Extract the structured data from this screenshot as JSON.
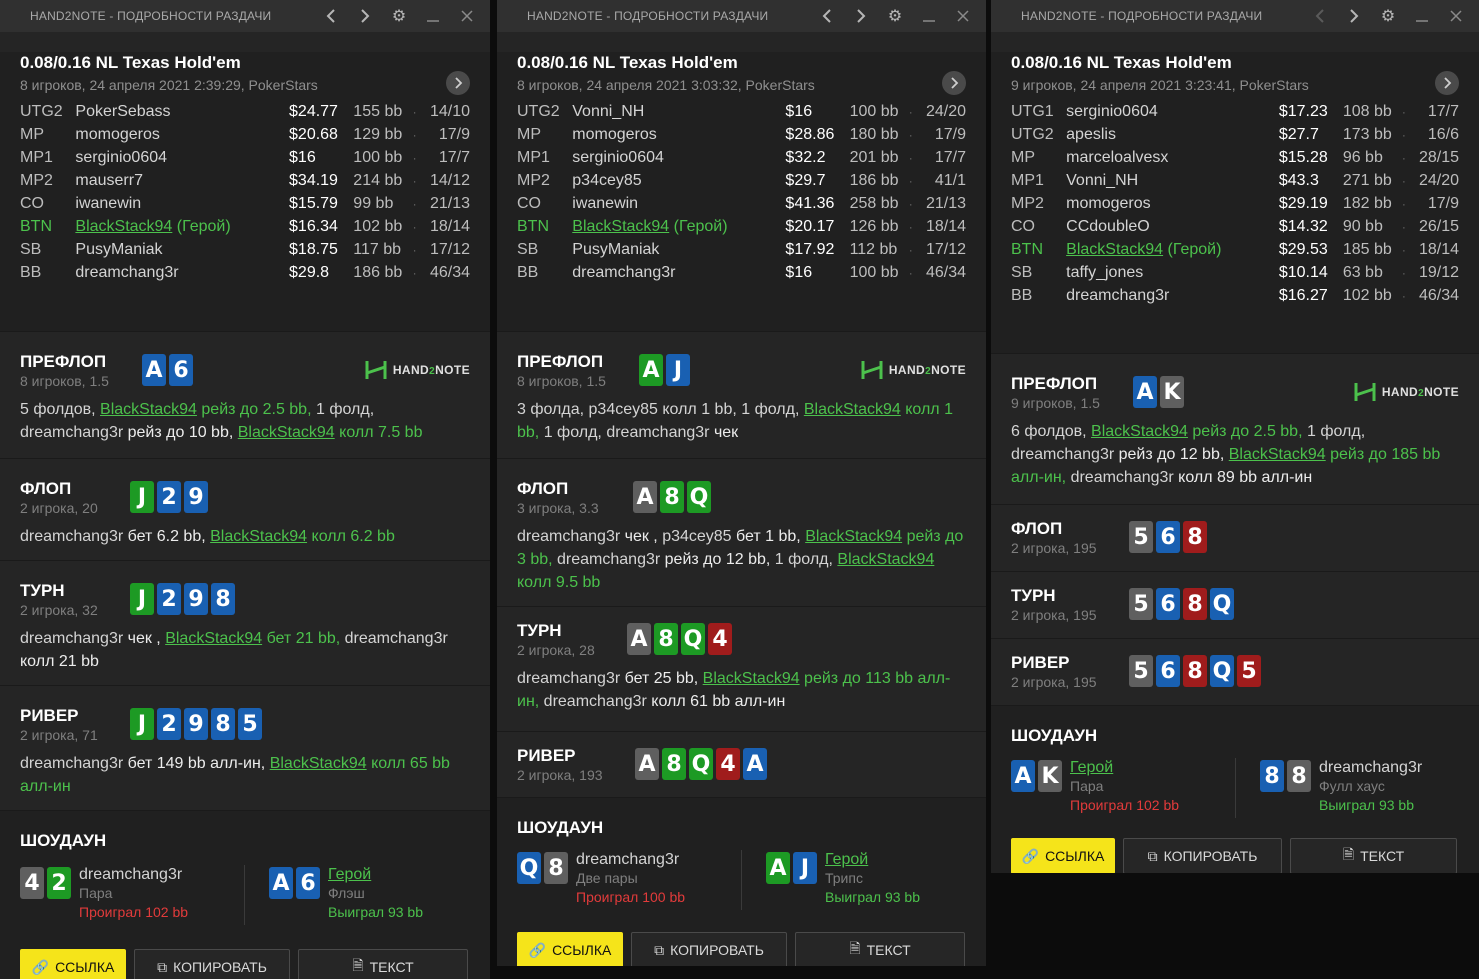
{
  "window_title": "HAND2NOTE - ПОДРОБНОСТИ РАЗДАЧИ",
  "logo_text": "HAND",
  "logo_num": "2",
  "logo_text2": "NOTE",
  "labels": {
    "preflop": "ПРЕФЛОП",
    "flop": "ФЛОП",
    "turn": "ТУРН",
    "river": "РИВЕР",
    "showdown": "ШОУДАУН",
    "btn_link": "ССЫЛКА",
    "btn_copy": "КОПИРОВАТЬ",
    "btn_text": "ТЕКСТ",
    "dot": "·"
  },
  "colors": {
    "hero": "#4cc14c",
    "lost": "#e23b3b",
    "button_yellow": "#f5e41a",
    "spade": "#5f5f5f",
    "heart": "#a01c1c",
    "diamond": "#1960b2",
    "club": "#1d9a24"
  },
  "panels": [
    {
      "game": "0.08/0.16 NL Texas Hold'em",
      "meta": "8 игроков, 24 апреля 2021 2:39:29, PokerStars",
      "players": [
        {
          "pos": "UTG2",
          "name": "PokerSebass",
          "stack": "$24.77",
          "bb": "155 bb",
          "cnt": "14/10"
        },
        {
          "pos": "MP",
          "name": "momogeros",
          "stack": "$20.68",
          "bb": "129 bb",
          "cnt": "17/9"
        },
        {
          "pos": "MP1",
          "name": "serginio0604",
          "stack": "$16",
          "bb": "100 bb",
          "cnt": "17/7"
        },
        {
          "pos": "MP2",
          "name": "mauserr7",
          "stack": "$34.19",
          "bb": "214 bb",
          "cnt": "14/12"
        },
        {
          "pos": "CO",
          "name": "iwanewin",
          "stack": "$15.79",
          "bb": "99 bb",
          "cnt": "21/13"
        },
        {
          "pos": "BTN",
          "name": "BlackStack94",
          "hero_tag": " (Герой)",
          "stack": "$16.34",
          "bb": "102 bb",
          "cnt": "18/14"
        },
        {
          "pos": "SB",
          "name": "PusyManiak",
          "stack": "$18.75",
          "bb": "117 bb",
          "cnt": "17/12"
        },
        {
          "pos": "BB",
          "name": "dreamchang3r",
          "stack": "$29.8",
          "bb": "186 bb",
          "cnt": "46/34"
        }
      ],
      "preflop": {
        "sub": "8 игроков, 1.5",
        "cards": [
          "A",
          "6"
        ]
      },
      "flop": {
        "sub": "2 игрока, 20",
        "cards": [
          "J",
          "2",
          "9"
        ]
      },
      "turn": {
        "sub": "2 игрока, 32",
        "cards": [
          "J",
          "2",
          "9",
          "8"
        ]
      },
      "river": {
        "sub": "2 игрока, 71",
        "cards": [
          "J",
          "2",
          "9",
          "8",
          "5"
        ]
      },
      "showdown": {
        "left": {
          "cards": [
            "4",
            "2"
          ],
          "name": "dreamchang3r",
          "hand": "Пара",
          "result": "Проиграл 102 bb"
        },
        "right": {
          "cards": [
            "A",
            "6"
          ],
          "name": "Герой",
          "hand": "Флэш",
          "result": "Выиграл 93 bb"
        }
      }
    },
    {
      "game": "0.08/0.16 NL Texas Hold'em",
      "meta": "8 игроков, 24 апреля 2021 3:03:32, PokerStars",
      "players": [
        {
          "pos": "UTG2",
          "name": "Vonni_NH",
          "stack": "$16",
          "bb": "100 bb",
          "cnt": "24/20"
        },
        {
          "pos": "MP",
          "name": "momogeros",
          "stack": "$28.86",
          "bb": "180 bb",
          "cnt": "17/9"
        },
        {
          "pos": "MP1",
          "name": "serginio0604",
          "stack": "$32.2",
          "bb": "201 bb",
          "cnt": "17/7"
        },
        {
          "pos": "MP2",
          "name": "p34cey85",
          "stack": "$29.7",
          "bb": "186 bb",
          "cnt": "41/1"
        },
        {
          "pos": "CO",
          "name": "iwanewin",
          "stack": "$41.36",
          "bb": "258 bb",
          "cnt": "21/13"
        },
        {
          "pos": "BTN",
          "name": "BlackStack94",
          "hero_tag": " (Герой)",
          "stack": "$20.17",
          "bb": "126 bb",
          "cnt": "18/14"
        },
        {
          "pos": "SB",
          "name": "PusyManiak",
          "stack": "$17.92",
          "bb": "112 bb",
          "cnt": "17/12"
        },
        {
          "pos": "BB",
          "name": "dreamchang3r",
          "stack": "$16",
          "bb": "100 bb",
          "cnt": "46/34"
        }
      ],
      "preflop": {
        "sub": "8 игроков, 1.5",
        "cards": [
          "A",
          "J"
        ]
      },
      "flop": {
        "sub": "3 игрока, 3.3",
        "cards": [
          "A",
          "8",
          "Q"
        ]
      },
      "turn": {
        "sub": "2 игрока, 28",
        "cards": [
          "A",
          "8",
          "Q",
          "4"
        ]
      },
      "river": {
        "sub": "2 игрока, 193",
        "cards": [
          "A",
          "8",
          "Q",
          "4",
          "A"
        ]
      },
      "showdown": {
        "left": {
          "cards": [
            "Q",
            "8"
          ],
          "name": "dreamchang3r",
          "hand": "Две пары",
          "result": "Проиграл 100 bb"
        },
        "right": {
          "cards": [
            "A",
            "J"
          ],
          "name": "Герой",
          "hand": "Трипс",
          "result": "Выиграл 93 bb"
        }
      }
    },
    {
      "game": "0.08/0.16 NL Texas Hold'em",
      "meta": "9 игроков, 24 апреля 2021 3:23:41, PokerStars",
      "players": [
        {
          "pos": "UTG1",
          "name": "serginio0604",
          "stack": "$17.23",
          "bb": "108 bb",
          "cnt": "17/7"
        },
        {
          "pos": "UTG2",
          "name": "apeslis",
          "stack": "$27.7",
          "bb": "173 bb",
          "cnt": "16/6"
        },
        {
          "pos": "MP",
          "name": "marceloalvesx",
          "stack": "$15.28",
          "bb": "96 bb",
          "cnt": "28/15"
        },
        {
          "pos": "MP1",
          "name": "Vonni_NH",
          "stack": "$43.3",
          "bb": "271 bb",
          "cnt": "24/20"
        },
        {
          "pos": "MP2",
          "name": "momogeros",
          "stack": "$29.19",
          "bb": "182 bb",
          "cnt": "17/9"
        },
        {
          "pos": "CO",
          "name": "CCdoubleO",
          "stack": "$14.32",
          "bb": "90 bb",
          "cnt": "26/15"
        },
        {
          "pos": "BTN",
          "name": "BlackStack94",
          "hero_tag": " (Герой)",
          "stack": "$29.53",
          "bb": "185 bb",
          "cnt": "18/14"
        },
        {
          "pos": "SB",
          "name": "taffy_jones",
          "stack": "$10.14",
          "bb": "63 bb",
          "cnt": "19/12"
        },
        {
          "pos": "BB",
          "name": "dreamchang3r",
          "stack": "$16.27",
          "bb": "102 bb",
          "cnt": "46/34"
        }
      ],
      "preflop": {
        "sub": "9 игроков, 1.5",
        "cards": [
          "A",
          "K"
        ]
      },
      "flop": {
        "sub": "2 игрока, 195",
        "cards": [
          "5",
          "6",
          "8"
        ]
      },
      "turn": {
        "sub": "2 игрока, 195",
        "cards": [
          "5",
          "6",
          "8",
          "Q"
        ]
      },
      "river": {
        "sub": "2 игрока, 195",
        "cards": [
          "5",
          "6",
          "8",
          "Q",
          "5"
        ]
      },
      "showdown": {
        "left": {
          "cards": [
            "A",
            "K"
          ],
          "name": "Герой",
          "hand": "Пара",
          "result": "Проиграл 102 bb"
        },
        "right": {
          "cards": [
            "8",
            "8"
          ],
          "name": "dreamchang3r",
          "hand": "Фулл хаус",
          "result": "Выиграл 93 bb"
        }
      }
    }
  ],
  "actions": {
    "p1_pre_a": "5 фолдов, ",
    "p1_pre_b": "BlackStack94",
    "p1_pre_c": " рейз до 2.5 bb,",
    "p1_pre_d": " 1 фолд,",
    "p1_pre_e": "dreamchang3r",
    "p1_pre_f": " рейз до 10 bb, ",
    "p1_pre_g": "BlackStack94",
    "p1_pre_h": " колл 7.5 bb",
    "p1_flop_a": "dreamchang3r",
    "p1_flop_b": " бет 6.2 bb, ",
    "p1_flop_c": "BlackStack94",
    "p1_flop_d": " колл 6.2 bb",
    "p1_turn_a": "dreamchang3r",
    "p1_turn_b": " чек , ",
    "p1_turn_c": "BlackStack94",
    "p1_turn_d": " бет 21 bb, ",
    "p1_turn_e": "dreamchang3r",
    "p1_turn_f": "колл 21 bb",
    "p1_river_a": "dreamchang3r",
    "p1_river_b": " бет 149 bb алл-ин, ",
    "p1_river_c": "BlackStack94",
    "p1_river_d": " колл 65 bb",
    "p1_river_e": "алл-ин",
    "p2_pre_a": "3 фолда, p34cey85 колл 1 bb, 1 фолд, ",
    "p2_pre_b": "BlackStack94",
    "p2_pre_c": " колл 1",
    "p2_pre_d": "bb,",
    "p2_pre_e": " 1 фолд, dreamchang3r ",
    "p2_pre_f": "чек",
    "p2_flop_a": "dreamchang3r",
    "p2_flop_b": " чек , ",
    "p2_flop_c": "p34cey85",
    "p2_flop_d": " бет 1 bb, ",
    "p2_flop_e": "BlackStack94",
    "p2_flop_f": " рейз до",
    "p2_flop_g": "3 bb, ",
    "p2_flop_h": "dreamchang3r",
    "p2_flop_i": " рейз до 12 bb, ",
    "p2_flop_j": "1 фолд, ",
    "p2_flop_k": "BlackStack94",
    "p2_flop_l": "колл 9.5 bb",
    "p2_turn_a": "dreamchang3r",
    "p2_turn_b": " бет 25 bb, ",
    "p2_turn_c": "BlackStack94",
    "p2_turn_d": " рейз до 113 bb алл-",
    "p2_turn_e": "ин, ",
    "p2_turn_f": "dreamchang3r",
    "p2_turn_g": " колл 61 bb алл-ин",
    "p3_pre_a": "6 фолдов, ",
    "p3_pre_b": "BlackStack94",
    "p3_pre_c": " рейз до 2.5 bb,",
    "p3_pre_d": " 1 фолд,",
    "p3_pre_e": "dreamchang3r",
    "p3_pre_f": " рейз до 12 bb, ",
    "p3_pre_g": "BlackStack94",
    "p3_pre_h": " рейз до 185 bb",
    "p3_pre_i": "алл-ин, ",
    "p3_pre_j": "dreamchang3r",
    "p3_pre_k": " колл 89 bb алл-ин"
  }
}
